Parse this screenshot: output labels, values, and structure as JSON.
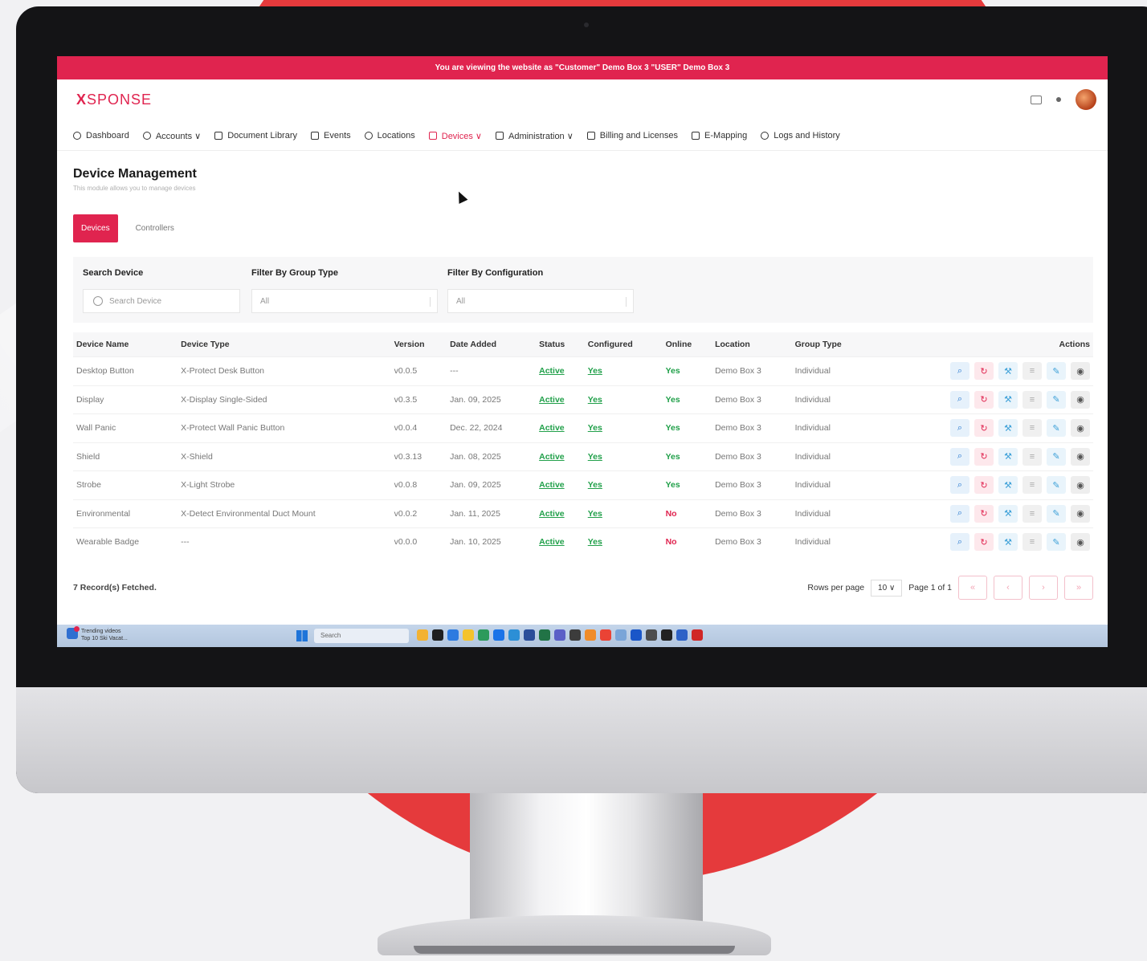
{
  "banner": {
    "text": "You are viewing the website as \"Customer\" Demo Box 3 \"USER\" Demo Box 3"
  },
  "brand": {
    "logo_x": "X",
    "logo_rest": "SPONSE",
    "accent": "#e0244f"
  },
  "nav": [
    {
      "label": "Dashboard",
      "icon": "dashboard-icon"
    },
    {
      "label": "Accounts ∨",
      "icon": "accounts-icon"
    },
    {
      "label": "Document Library",
      "icon": "document-icon"
    },
    {
      "label": "Events",
      "icon": "calendar-icon"
    },
    {
      "label": "Locations",
      "icon": "location-pin-icon"
    },
    {
      "label": "Devices ∨",
      "icon": "devices-icon",
      "active": true
    },
    {
      "label": "Administration ∨",
      "icon": "folder-icon"
    },
    {
      "label": "Billing and Licenses",
      "icon": "billing-icon"
    },
    {
      "label": "E-Mapping",
      "icon": "map-icon"
    },
    {
      "label": "Logs and History",
      "icon": "history-icon"
    }
  ],
  "page": {
    "title": "Device Management",
    "subtitle": "This module allows you to manage devices"
  },
  "tabs": {
    "devices": "Devices",
    "controllers": "Controllers"
  },
  "filters": {
    "search_label": "Search Device",
    "search_placeholder": "Search Device",
    "group_label": "Filter By Group Type",
    "group_value": "All",
    "config_label": "Filter By Configuration",
    "config_value": "All"
  },
  "table": {
    "headers": [
      "Device Name",
      "Device Type",
      "Version",
      "Date Added",
      "Status",
      "Configured",
      "Online",
      "Location",
      "Group Type",
      "Actions"
    ],
    "rows": [
      {
        "name": "Desktop Button",
        "type": "X-Protect Desk Button",
        "version": "v0.0.5",
        "date": "---",
        "status": "Active",
        "configured": "Yes",
        "online": "Yes",
        "location": "Demo Box 3",
        "group": "Individual"
      },
      {
        "name": "Display",
        "type": "X-Display Single-Sided",
        "version": "v0.3.5",
        "date": "Jan. 09, 2025",
        "status": "Active",
        "configured": "Yes",
        "online": "Yes",
        "location": "Demo Box 3",
        "group": "Individual"
      },
      {
        "name": "Wall Panic",
        "type": "X-Protect Wall Panic Button",
        "version": "v0.0.4",
        "date": "Dec. 22, 2024",
        "status": "Active",
        "configured": "Yes",
        "online": "Yes",
        "location": "Demo Box 3",
        "group": "Individual"
      },
      {
        "name": "Shield",
        "type": "X-Shield",
        "version": "v0.3.13",
        "date": "Jan. 08, 2025",
        "status": "Active",
        "configured": "Yes",
        "online": "Yes",
        "location": "Demo Box 3",
        "group": "Individual"
      },
      {
        "name": "Strobe",
        "type": "X-Light Strobe",
        "version": "v0.0.8",
        "date": "Jan. 09, 2025",
        "status": "Active",
        "configured": "Yes",
        "online": "Yes",
        "location": "Demo Box 3",
        "group": "Individual"
      },
      {
        "name": "Environmental",
        "type": "X-Detect Environmental Duct Mount",
        "version": "v0.0.2",
        "date": "Jan. 11, 2025",
        "status": "Active",
        "configured": "Yes",
        "online": "No",
        "location": "Demo Box 3",
        "group": "Individual"
      },
      {
        "name": "Wearable Badge",
        "type": "---",
        "version": "v0.0.0",
        "date": "Jan. 10, 2025",
        "status": "Active",
        "configured": "Yes",
        "online": "No",
        "location": "Demo Box 3",
        "group": "Individual"
      }
    ]
  },
  "footer": {
    "records": "7 Record(s) Fetched.",
    "rows_per_page_label": "Rows per page",
    "rows_per_page_value": "10 ∨",
    "page_info": "Page 1 of 1"
  },
  "taskbar": {
    "news_title": "Trending videos",
    "news_sub": "Top 10 Ski Vacat...",
    "search_placeholder": "Search"
  }
}
